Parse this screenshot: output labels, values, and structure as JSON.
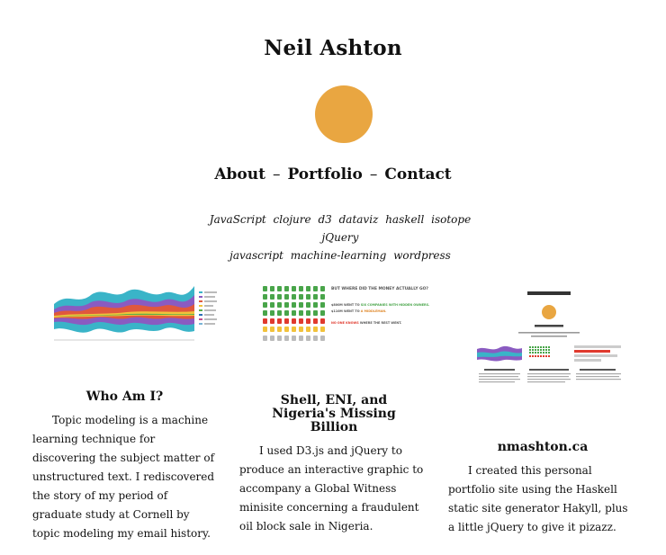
{
  "site": {
    "title": "Neil Ashton",
    "accent_color": "#e9a641"
  },
  "nav": {
    "items": [
      "About",
      "Portfolio",
      "Contact"
    ],
    "separator": "–"
  },
  "tags": {
    "row1": [
      "JavaScript",
      "clojure",
      "d3",
      "dataviz",
      "haskell",
      "isotope",
      "jQuery"
    ],
    "row2": [
      "javascript",
      "machine-learning",
      "wordpress"
    ]
  },
  "projects": [
    {
      "thumb_icon": "streamgraph-thumbnail",
      "title": "Who Am I?",
      "description": "Topic modeling is a machine learning technique for discovering the subject matter of unstructured text. I rediscovered the story of my period of graduate study at Cornell by topic modeling my email history."
    },
    {
      "thumb_icon": "money-infographic-thumbnail",
      "title": "Shell, ENI, and Nigeria's Missing Billion",
      "description": "I used D3.js and jQuery to produce an interactive graphic to accompany a Global Witness minisite concerning a fraudulent oil block sale in Nigeria.",
      "thumb_text": {
        "headline": "BUT WHERE DID THE MONEY ACTUALLY GO?",
        "line1a": "$800M WENT TO ",
        "line1b": "SIX COMPANIES WITH HIDDEN OWNERS.",
        "line1c": " $110M WENT TO ",
        "line1d": "A MIDDLEMAN.",
        "line2a": "NO ONE KNOWS",
        "line2b": " WHERE THE REST WENT."
      }
    },
    {
      "thumb_icon": "site-preview-thumbnail",
      "title": "nmashton.ca",
      "description": "I created this personal portfolio site using the Haskell static site generator Hakyll, plus a little jQuery to give it pizazz."
    }
  ]
}
